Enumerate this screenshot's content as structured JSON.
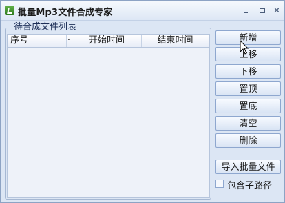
{
  "window": {
    "title": "批量Mp3文件合成专家",
    "close_glyph": "×"
  },
  "group": {
    "title": "待合成文件列表",
    "columns": [
      "序号",
      "·",
      "开始时间",
      "结束时间"
    ]
  },
  "buttons": {
    "add": "新增",
    "up": "上移",
    "down": "下移",
    "top": "置顶",
    "bottom": "置底",
    "clear": "清空",
    "delete": "删除",
    "import": "导入批量文件"
  },
  "option": {
    "include_subpath": "包含子路径",
    "checked": false
  },
  "colors": {
    "bg": "#dce6f4",
    "border": "#8ea7cf",
    "accent": "#1d2f58"
  }
}
